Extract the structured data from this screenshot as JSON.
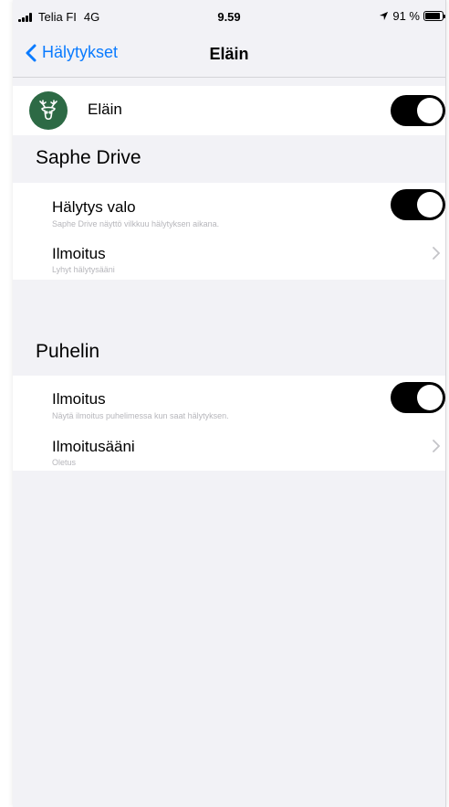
{
  "status_bar": {
    "carrier": "Telia FI",
    "network": "4G",
    "time": "9.59",
    "battery": "91 %",
    "icons": [
      "signal-icon",
      "location-arrow-icon",
      "battery-icon"
    ]
  },
  "nav": {
    "back_label": "Hälytykset",
    "title": "Eläin"
  },
  "top_item": {
    "label": "Eläin",
    "icon": "deer-icon",
    "toggle_on": true
  },
  "saphe": {
    "header": "Saphe Drive",
    "rows": [
      {
        "title": "Hälytys valo",
        "subtitle": "Saphe Drive näyttö vilkkuu hälytyksen aikana.",
        "control": "toggle",
        "on": true
      },
      {
        "title": "Ilmoitus",
        "subtitle": "Lyhyt hälytysääni",
        "control": "chevron"
      }
    ]
  },
  "phone": {
    "header": "Puhelin",
    "rows": [
      {
        "title": "Ilmoitus",
        "subtitle": "Näytä ilmoitus puhelimessa kun saat hälytyksen.",
        "control": "toggle",
        "on": true
      },
      {
        "title": "Ilmoitusääni",
        "subtitle": "Oletus",
        "control": "chevron"
      }
    ]
  },
  "colors": {
    "accent": "#0a7bff",
    "toggle_on": "#000000",
    "background": "#f2f2f6",
    "avatar_bg": "#2d6a45",
    "subtitle": "#b6b6bb"
  }
}
